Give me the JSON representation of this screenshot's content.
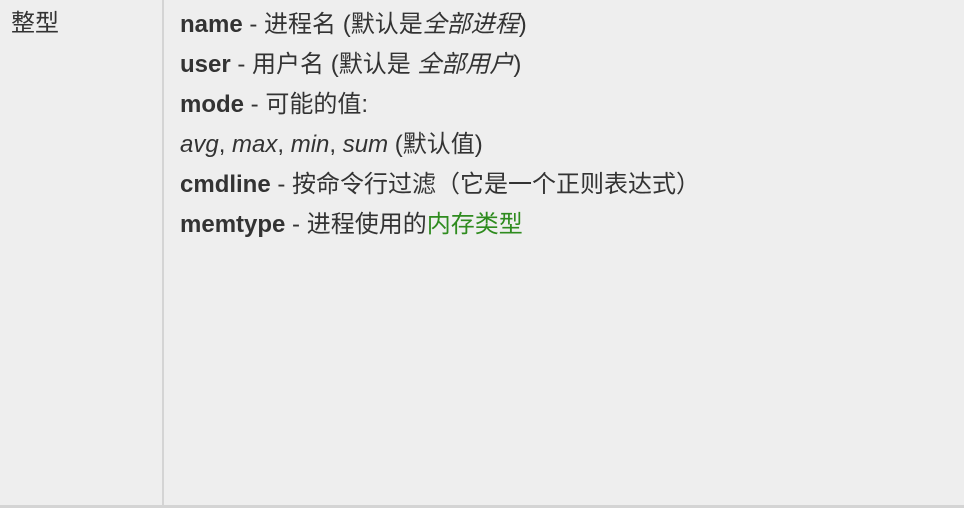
{
  "type_cell": {
    "label": "整型"
  },
  "params": {
    "name": {
      "key": "name",
      "sep": " - ",
      "desc": "进程名 (默认是",
      "default": "全部进程",
      "close": ")"
    },
    "user": {
      "key": "user",
      "sep": " - ",
      "desc": "用户名 (默认是 ",
      "default": "全部用户",
      "close": ")"
    },
    "mode": {
      "key": "mode",
      "sep": " - ",
      "desc": "可能的值:",
      "values": [
        "avg",
        "max",
        "min",
        "sum"
      ],
      "comma": ", ",
      "default_note": " (默认值)"
    },
    "cmdline": {
      "key": "cmdline",
      "sep": " - ",
      "desc": "按命令行过滤（它是一个正则表达式）"
    },
    "memtype": {
      "key": "memtype",
      "sep": " - ",
      "desc": "进程使用的",
      "link": "内存类型"
    }
  },
  "colors": {
    "background": "#eeeeee",
    "text": "#333333",
    "border": "#d4d4d4",
    "link": "#2e8b1e"
  }
}
